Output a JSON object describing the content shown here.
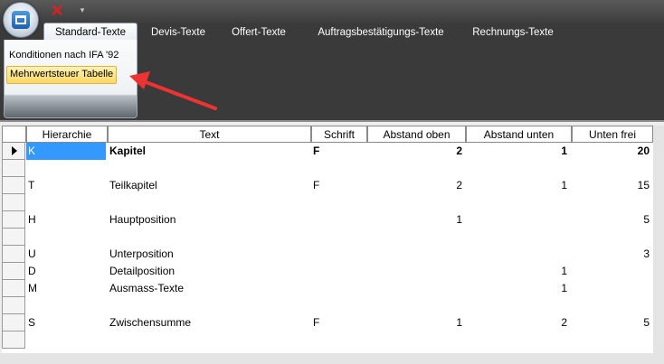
{
  "ribbon": {
    "tabs": [
      "Standard-Texte",
      "Devis-Texte",
      "Offert-Texte",
      "Auftragsbestätigungs-Texte",
      "Rechnungs-Texte"
    ],
    "active_tab": "Standard-Texte",
    "buttons": [
      "Konditionen nach IFA '92",
      "Mehrwertsteuer Tabelle"
    ],
    "quick_access": {
      "close_icon": "close-icon",
      "dropdown": "▾"
    }
  },
  "grid": {
    "columns": [
      "Hierarchie",
      "Text",
      "Schrift",
      "Abstand oben",
      "Abstand unten",
      "Unten frei"
    ],
    "rows": [
      {
        "hierarchie": "K",
        "text": "Kapitel",
        "schrift": "F",
        "oben": "2",
        "unten": "1",
        "frei": "20",
        "bold": true,
        "current": true
      },
      {
        "hierarchie": "",
        "text": "",
        "schrift": "",
        "oben": "",
        "unten": "",
        "frei": ""
      },
      {
        "hierarchie": "T",
        "text": "Teilkapitel",
        "schrift": "F",
        "oben": "2",
        "unten": "1",
        "frei": "15"
      },
      {
        "hierarchie": "",
        "text": "",
        "schrift": "",
        "oben": "",
        "unten": "",
        "frei": ""
      },
      {
        "hierarchie": "H",
        "text": "Hauptposition",
        "schrift": "",
        "oben": "1",
        "unten": "",
        "frei": "5"
      },
      {
        "hierarchie": "",
        "text": "",
        "schrift": "",
        "oben": "",
        "unten": "",
        "frei": ""
      },
      {
        "hierarchie": "U",
        "text": "Unterposition",
        "schrift": "",
        "oben": "",
        "unten": "",
        "frei": "3"
      },
      {
        "hierarchie": "D",
        "text": "Detailposition",
        "schrift": "",
        "oben": "",
        "unten": "1",
        "frei": ""
      },
      {
        "hierarchie": "M",
        "text": "Ausmass-Texte",
        "schrift": "",
        "oben": "",
        "unten": "1",
        "frei": ""
      },
      {
        "hierarchie": "",
        "text": "",
        "schrift": "",
        "oben": "",
        "unten": "",
        "frei": ""
      },
      {
        "hierarchie": "S",
        "text": "Zwischensumme",
        "schrift": "F",
        "oben": "1",
        "unten": "2",
        "frei": "5"
      },
      {
        "hierarchie": "",
        "text": "",
        "schrift": "",
        "oben": "",
        "unten": "",
        "frei": ""
      }
    ]
  }
}
